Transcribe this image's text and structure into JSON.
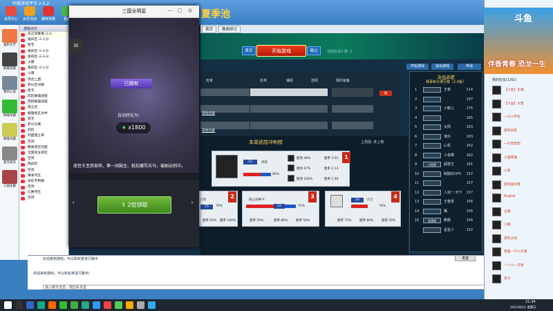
{
  "client": {
    "title": "同城游戏平台 2.0.2",
    "top_icons": [
      {
        "label": "会员中心",
        "color": "#e84a3c",
        "icon": "member-icon"
      },
      {
        "label": "会员活动",
        "color": "#f0a020",
        "icon": "activity-icon"
      },
      {
        "label": "趣味竞赛",
        "color": "#d33",
        "icon": "contest-icon"
      },
      {
        "label": "我的",
        "color": "#4cb848",
        "icon": "mine-icon"
      }
    ]
  },
  "leftbar": [
    {
      "label": "福利大厅",
      "color": "#e74"
    },
    {
      "label": "群雄逐鹿",
      "color": "#444"
    },
    {
      "label": "我的公会",
      "color": "#789"
    },
    {
      "label": "群雄争霸",
      "color": "#3b3"
    },
    {
      "label": "群雄争霸",
      "color": "#cc5"
    },
    {
      "label": "金元挑马",
      "color": "#888"
    },
    {
      "label": "三国争霸",
      "color": "#a44"
    }
  ],
  "roomlist": {
    "header": "游戏大厅",
    "items": [
      "非正常赛事-三十",
      "第四区-三十分",
      "暂无",
      "第四区-三十分",
      "第四区-三十分",
      "火爆",
      "第四区-三十分",
      "火爆",
      "场合上面",
      "积分区间赛",
      "暂无",
      "四区群雄逐鹿",
      "团结群雄逐鹿",
      "第五区",
      "群雄各区合并",
      "暂无",
      "积分比赛",
      "四区",
      "同盟建立率",
      "空闲",
      "聚集各区同盟",
      "全国同业率区",
      "空闲",
      "挑战区",
      "空闲",
      "赛事专区",
      "本区专用赛",
      "空闲",
      "比赛专区",
      "空闲"
    ]
  },
  "game": {
    "tabs": [
      "首页",
      "鹿鼎师记"
    ],
    "banner_title": "夏季池",
    "start_btn": "开始游戏",
    "left_btn": "首页",
    "right_btn": "跳过",
    "status": "当前在线人数: 1",
    "top_buttons": [
      "开始游戏",
      "退出游戏",
      "申请"
    ],
    "table_headers": [
      "玩家",
      "名将",
      "辅助",
      "选助",
      "我的装备"
    ],
    "players": [
      {
        "name": "游戏玩家"
      },
      {
        "name": "游戏玩家"
      },
      {
        "name": "游戏玩家"
      }
    ],
    "weekly": {
      "title": "本周武勋冲刺榜",
      "info": "上周勋: 未上榜",
      "main": {
        "level": "53",
        "name": "鸿风",
        "percent": "85%",
        "stats": [
          "胜场 48%",
          "胜率 3.01",
          "胜场 67%",
          "胜率 2.13",
          "胜场 100%",
          "胜率 1.90"
        ],
        "rank": "1"
      },
      "cards": [
        {
          "rank": "2",
          "name": "小刘",
          "level": "75",
          "pct": "79%",
          "stats": [
            "胜率 50%",
            "胜率 100%"
          ]
        },
        {
          "rank": "3",
          "name": "伤心剑神-X",
          "level": "12",
          "pct": "75%",
          "stats": [
            "胜率 50%",
            "胜率 86%",
            "胜率 50%"
          ]
        },
        {
          "rank": "4",
          "name": "小刀",
          "level": "10",
          "pct": "76%",
          "stats": [
            "胜率 75%",
            "胜率 80%",
            "胜率 50%"
          ]
        }
      ]
    },
    "rank": {
      "title": "决战赤壁",
      "subtitle": "赛事积分排行榜（2.0版）",
      "rows": [
        {
          "n": "1",
          "badge": "",
          "name": "王者",
          "pts": "214"
        },
        {
          "n": "2",
          "badge": "",
          "name": "",
          "pts": "197"
        },
        {
          "n": "3",
          "badge": "",
          "name": "小鹏儿",
          "pts": "175"
        },
        {
          "n": "4",
          "badge": "",
          "name": "",
          "pts": "165"
        },
        {
          "n": "5",
          "badge": "",
          "name": "太阳",
          "pts": "163"
        },
        {
          "n": "6",
          "badge": "",
          "name": "谁外",
          "pts": "163"
        },
        {
          "n": "7",
          "badge": "",
          "name": "心机",
          "pts": "162"
        },
        {
          "n": "8",
          "badge": "",
          "name": "小丧卿",
          "pts": "162"
        },
        {
          "n": "9",
          "badge": "小哥哥",
          "name": "超棍王",
          "pts": "161"
        },
        {
          "n": "10",
          "badge": "",
          "name": "制服的OPS",
          "pts": "157"
        },
        {
          "n": "11",
          "badge": "",
          "name": "",
          "pts": "157"
        },
        {
          "n": "12",
          "badge": "",
          "name": "人剑一·天下",
          "pts": "157"
        },
        {
          "n": "13",
          "badge": "",
          "name": "王春雷",
          "pts": "156"
        },
        {
          "n": "14",
          "badge": "",
          "name": "鹰",
          "pts": "156"
        },
        {
          "n": "15",
          "badge": "导演组",
          "name": "鹏飘",
          "pts": "156"
        },
        {
          "n": "",
          "badge": "",
          "name": "星星少",
          "pts": "152"
        }
      ]
    }
  },
  "popup": {
    "title": "三国全明星",
    "owned": "已拥有",
    "auto_convert": "自动转化为:",
    "gem_amount": "x1800",
    "description": "南宫王圣获部将。第一阔副主、抵抗魔军兵马，被剧云则中。",
    "claim_btn": "2倍领取",
    "controls": [
      "—",
      "□",
      "◎"
    ]
  },
  "chat": {
    "line1": "欢迎来到游戏，可以和玩家进行聊天",
    "line2": "欢迎来到游戏，可以和玩家进行聊天!",
    "input_placeholder": "输入聊天信息，按回车发送",
    "send": "发送"
  },
  "rightpanel": {
    "ad_logo": "斗鱼",
    "ad_text": "伴香青春 恐龙一生",
    "self_name": "我的好友(1/92)",
    "users": [
      "【斗鱼】主播",
      "【斗鱼】大佬",
      "一只小学生",
      "游戏好友",
      "一只老奶奶",
      "三国英雄",
      "小黑",
      "游戏爱好者",
      "Anglsd",
      "主播",
      "小鹿",
      "游戏大哥",
      "我是一只小可爱",
      "一个十一可爱",
      "老大"
    ]
  },
  "taskbar": {
    "time": "21:34",
    "date": "2021/8/11 星期三"
  }
}
